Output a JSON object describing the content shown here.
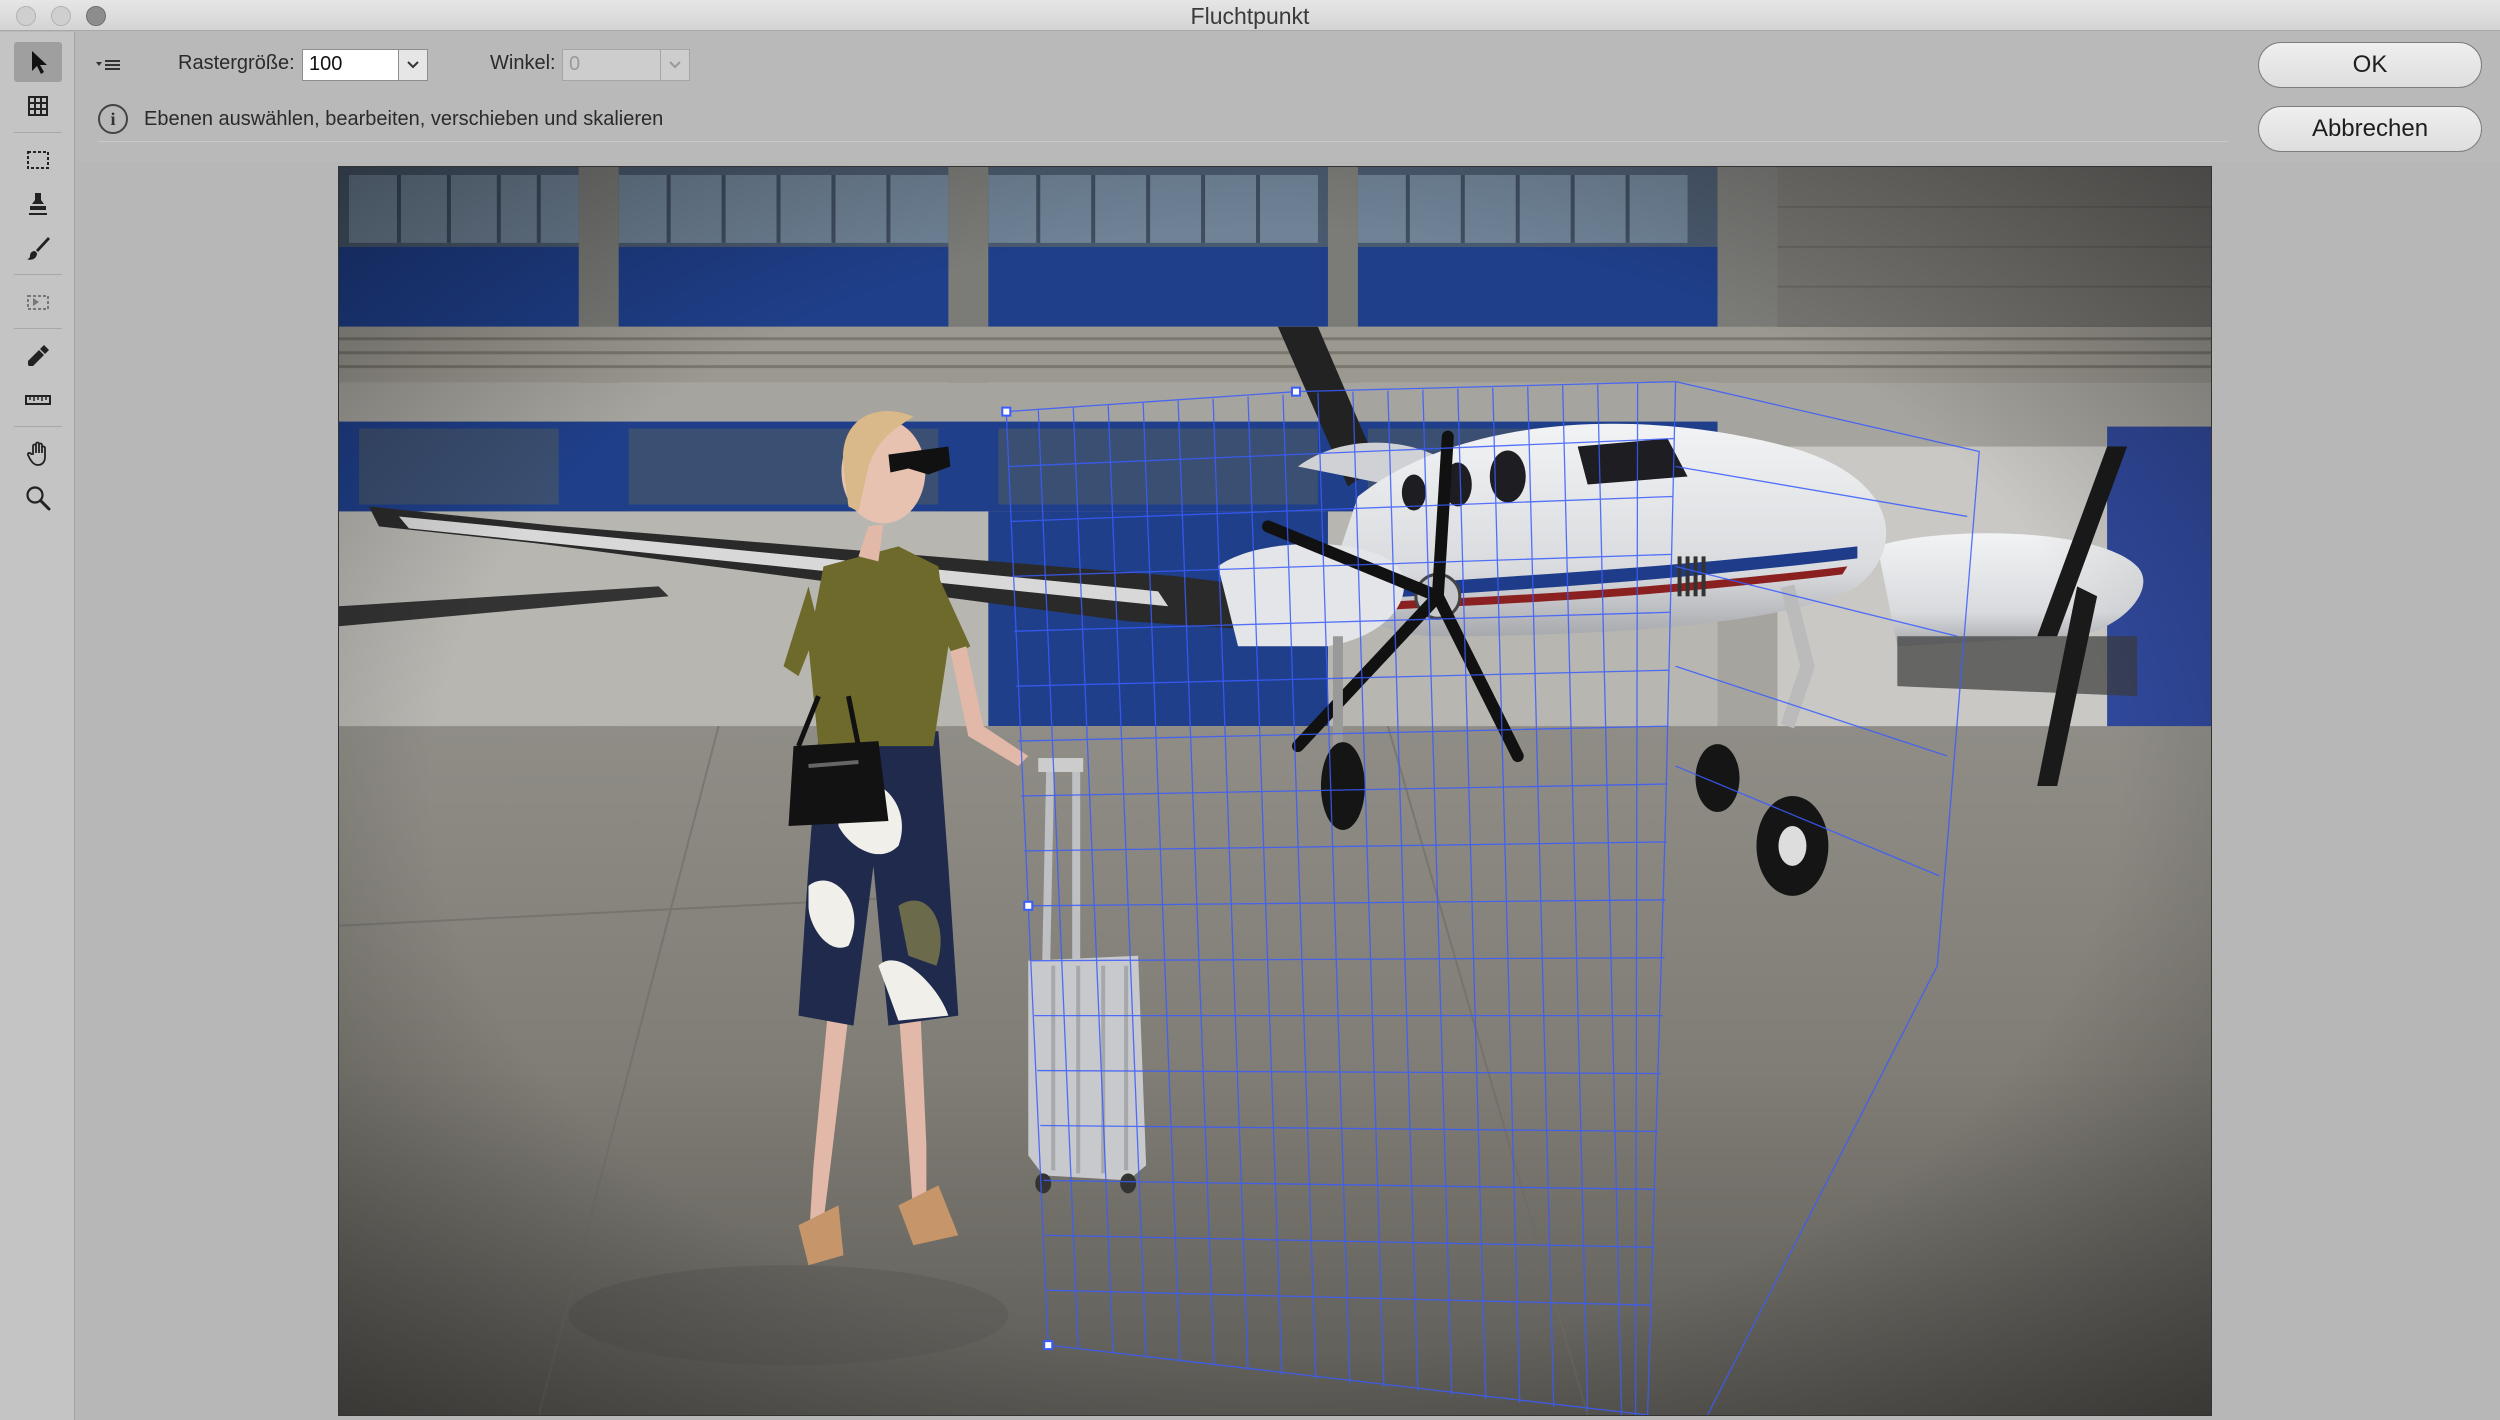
{
  "window": {
    "title": "Fluchtpunkt"
  },
  "tools": [
    {
      "name": "edit-plane-tool",
      "icon": "arrow-pointer-icon",
      "active": true
    },
    {
      "name": "create-plane-tool",
      "icon": "grid-plane-icon"
    },
    {
      "name": "marquee-tool",
      "icon": "marquee-icon"
    },
    {
      "name": "stamp-tool",
      "icon": "stamp-icon"
    },
    {
      "name": "brush-tool",
      "icon": "brush-icon"
    },
    {
      "name": "transform-tool",
      "icon": "transform-icon"
    },
    {
      "name": "eyedropper-tool",
      "icon": "eyedropper-icon"
    },
    {
      "name": "measure-tool",
      "icon": "ruler-icon"
    },
    {
      "name": "hand-tool",
      "icon": "hand-icon"
    },
    {
      "name": "zoom-tool",
      "icon": "zoom-icon"
    }
  ],
  "options": {
    "grid_size_label": "Rastergröße:",
    "grid_size_value": "100",
    "angle_label": "Winkel:",
    "angle_value": "0",
    "info_text": "Ebenen auswählen, bearbeiten, verschieben und skalieren"
  },
  "buttons": {
    "ok": "OK",
    "cancel": "Abbrechen"
  },
  "colors": {
    "grid_line": "#3a5cff",
    "hangar_blue": "#1f3f8a",
    "background": "#b9b9b9"
  }
}
